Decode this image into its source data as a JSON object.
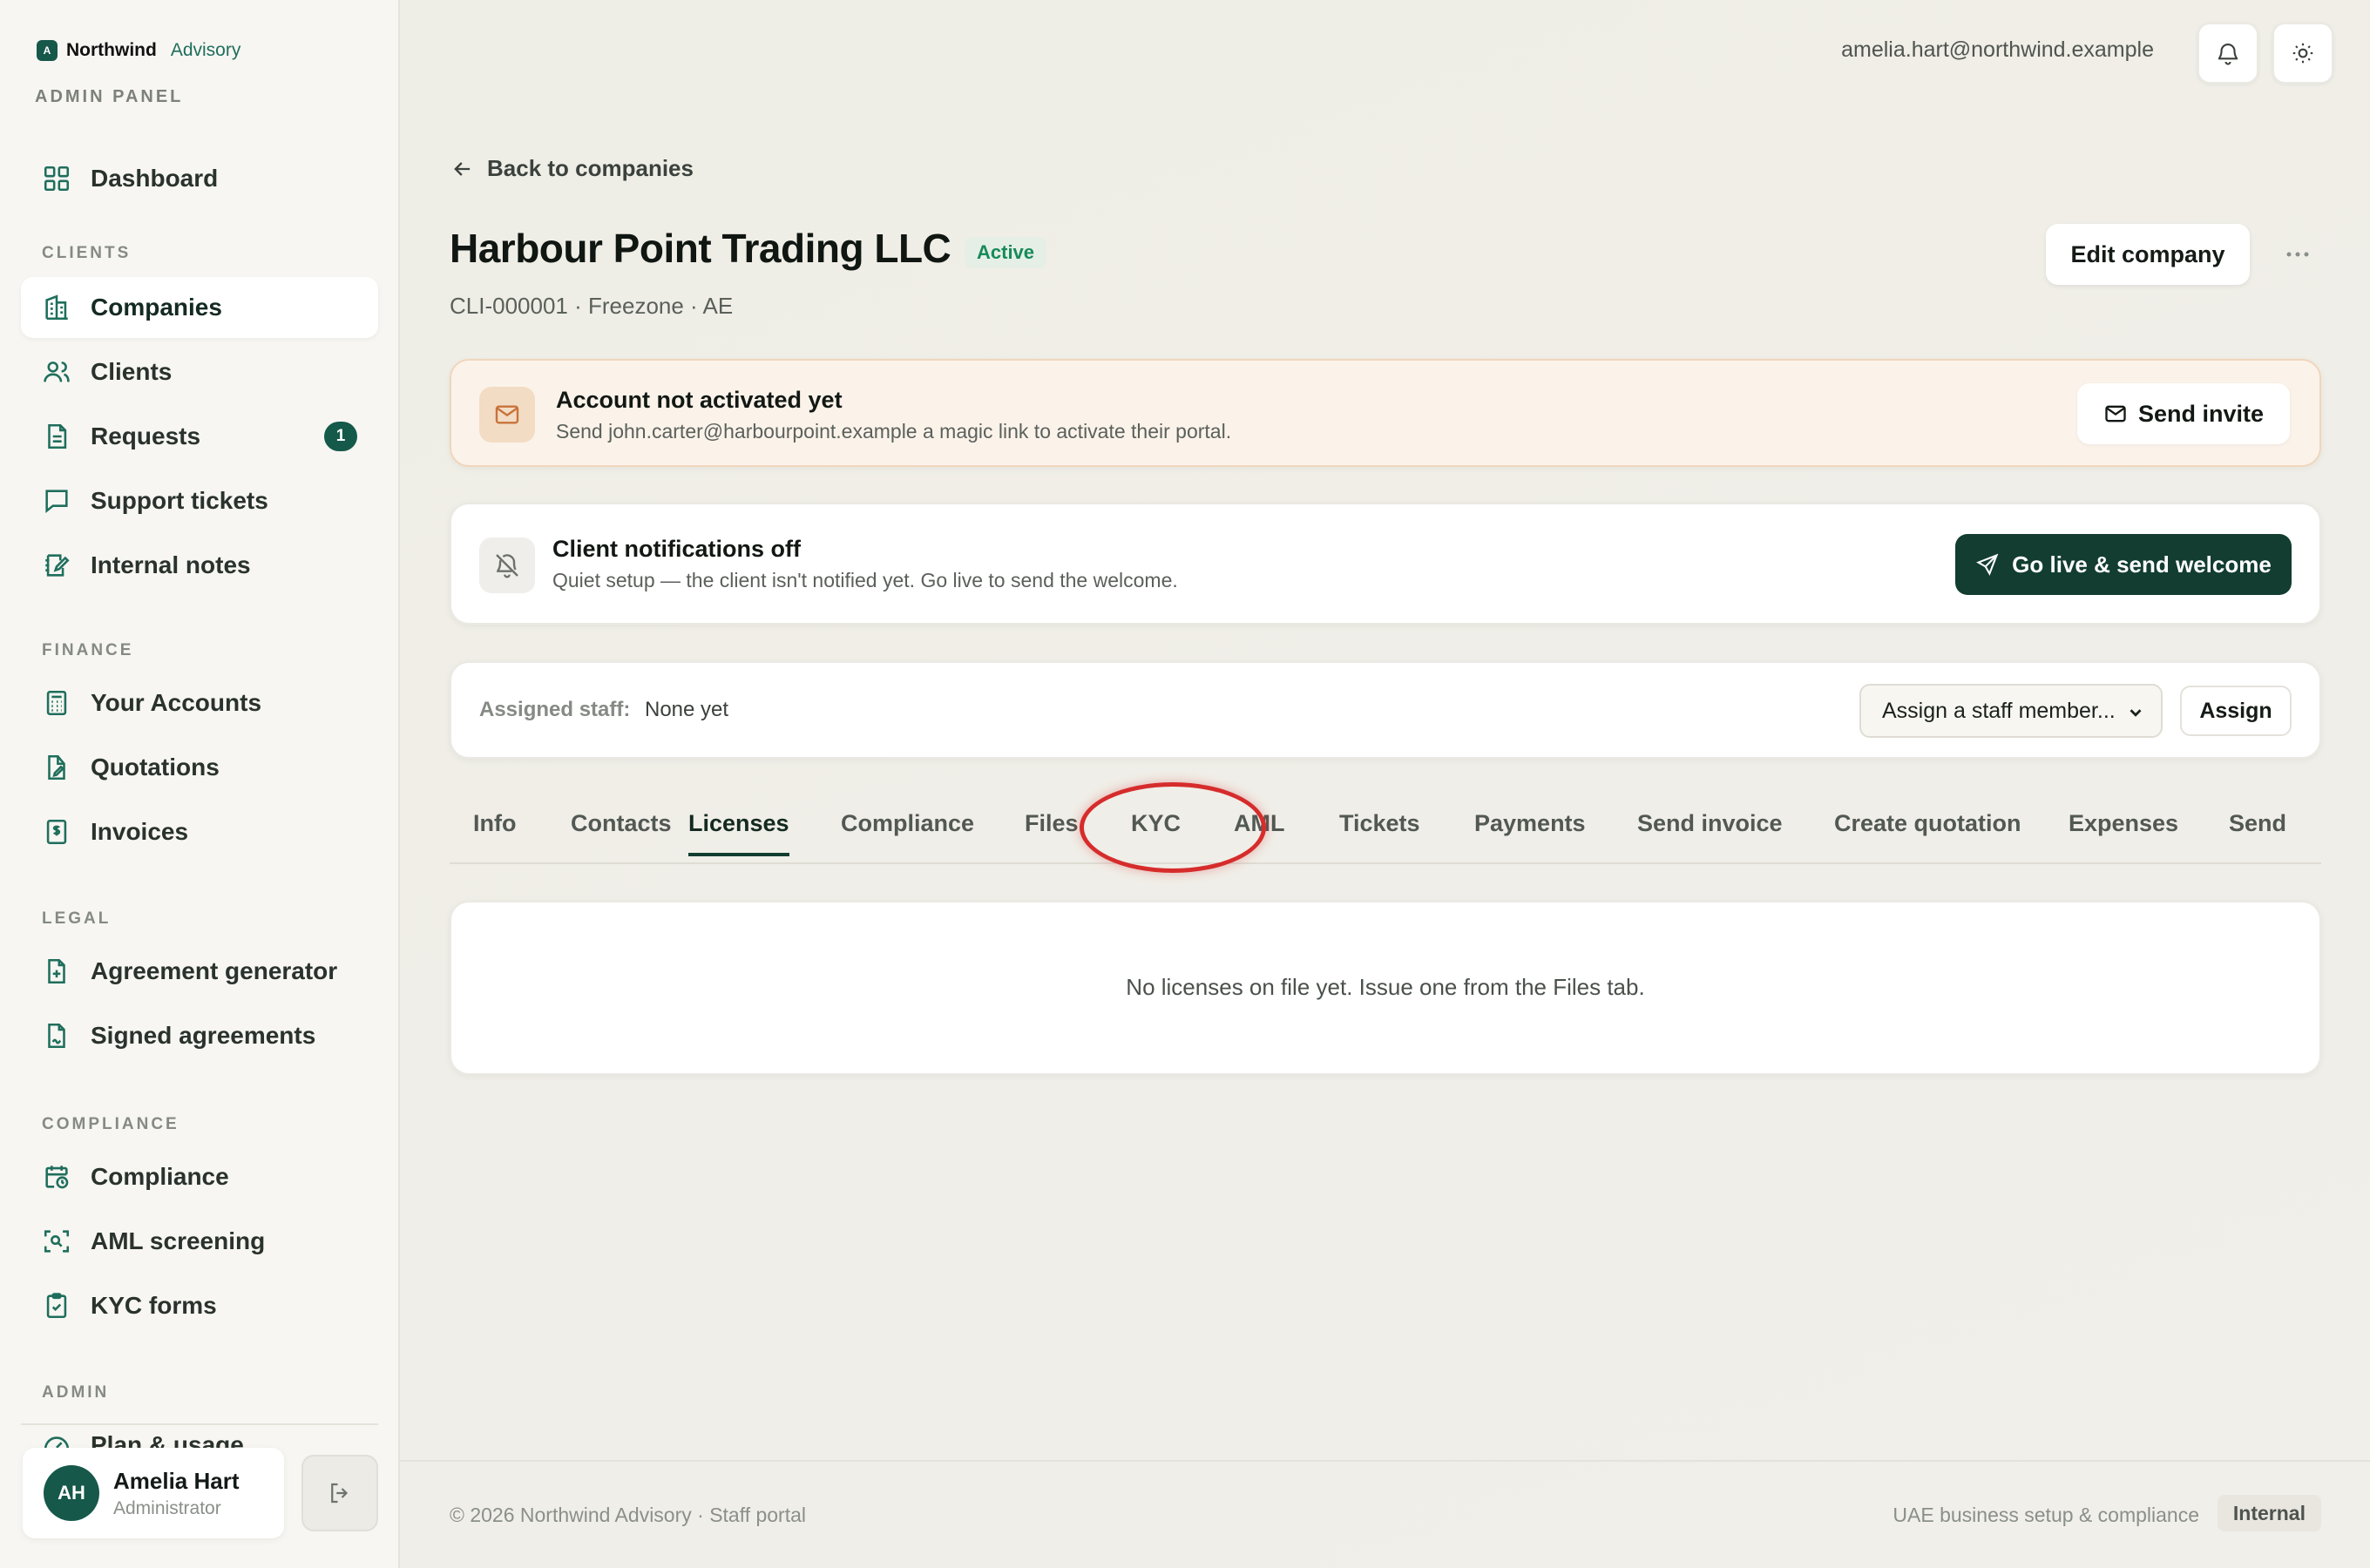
{
  "brand": {
    "mark": "A",
    "name": "Northwind",
    "sub": "Advisory",
    "panel_label": "ADMIN PANEL"
  },
  "sidebar": {
    "top_item": {
      "label": "Dashboard"
    },
    "groups": [
      {
        "label": "CLIENTS",
        "items": [
          {
            "label": "Companies",
            "active": true
          },
          {
            "label": "Clients"
          },
          {
            "label": "Requests",
            "badge": "1"
          },
          {
            "label": "Support tickets"
          },
          {
            "label": "Internal notes"
          }
        ]
      },
      {
        "label": "FINANCE",
        "items": [
          {
            "label": "Your Accounts"
          },
          {
            "label": "Quotations"
          },
          {
            "label": "Invoices"
          }
        ]
      },
      {
        "label": "LEGAL",
        "items": [
          {
            "label": "Agreement generator"
          },
          {
            "label": "Signed agreements"
          }
        ]
      },
      {
        "label": "COMPLIANCE",
        "items": [
          {
            "label": "Compliance"
          },
          {
            "label": "AML screening"
          },
          {
            "label": "KYC forms"
          }
        ]
      },
      {
        "label": "ADMIN",
        "items": [
          {
            "label": "Plan & usage"
          }
        ]
      }
    ],
    "user": {
      "initials": "AH",
      "name": "Amelia Hart",
      "role": "Administrator"
    }
  },
  "topbar": {
    "email": "amelia.hart@northwind.example"
  },
  "page": {
    "back_label": "Back to companies",
    "title": "Harbour Point Trading LLC",
    "status": "Active",
    "meta": "CLI-000001 · Freezone · AE",
    "edit_label": "Edit company"
  },
  "alert": {
    "title": "Account not activated yet",
    "desc": "Send john.carter@harbourpoint.example a magic link to activate their portal.",
    "button": "Send invite"
  },
  "notifications": {
    "title": "Client notifications off",
    "desc": "Quiet setup — the client isn't notified yet. Go live to send the welcome.",
    "button": "Go live & send welcome"
  },
  "staff": {
    "label": "Assigned staff:",
    "value": "None yet",
    "select_value": "Assign a staff member...",
    "assign_label": "Assign"
  },
  "tabs": [
    "Info",
    "Contacts",
    "Licenses",
    "Compliance",
    "Files",
    "KYC",
    "AML",
    "Tickets",
    "Payments",
    "Send invoice",
    "Create quotation",
    "Expenses",
    "Send"
  ],
  "active_tab": "Licenses",
  "content": {
    "empty": "No licenses on file yet. Issue one from the Files tab."
  },
  "footer": {
    "left": "© 2026 Northwind Advisory · Staff portal",
    "right": "UAE business setup & compliance",
    "tag": "Internal"
  },
  "colors": {
    "accent": "#123d30",
    "badge": "#15594a",
    "active_status": "#178a5a",
    "annotation": "#d62c2c"
  }
}
